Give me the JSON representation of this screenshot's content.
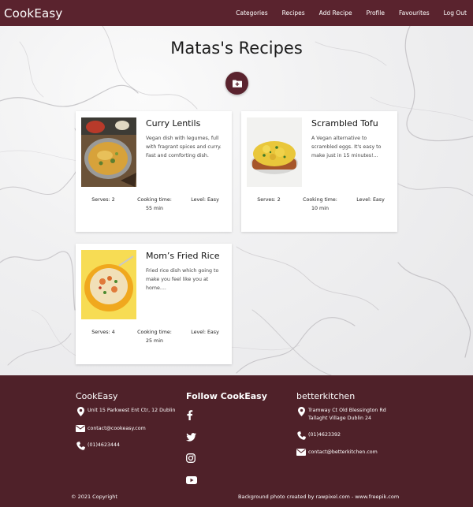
{
  "navbar": {
    "brand": "CookEasy",
    "links": [
      "Categories",
      "Recipes",
      "Add Recipe",
      "Profile",
      "Favourites",
      "Log Out"
    ]
  },
  "page": {
    "title": "Matas's Recipes",
    "add_icon": "folder-plus-icon"
  },
  "recipes": [
    {
      "title": "Curry Lentils",
      "description": "Vegan dish with legumes, full with fragrant spices and curry. Fast and comforting dish.",
      "serves": "Serves: 2",
      "time_label": "Cooking time:",
      "time_value": "55 min",
      "level": "Level: Easy"
    },
    {
      "title": "Scrambled Tofu",
      "description": "A Vegan alternative to scrambled eggs. It's easy to make just in 15 minutes!...",
      "serves": "Serves: 2",
      "time_label": "Cooking time:",
      "time_value": "10 min",
      "level": "Level: Easy"
    },
    {
      "title": "Mom’s Fried Rice",
      "description": "Fried rice dish which going to make you feel like you at home....",
      "serves": "Serves: 4",
      "time_label": "Cooking time:",
      "time_value": "25 min",
      "level": "Level: Easy"
    }
  ],
  "footer": {
    "col1": {
      "heading": "CookEasy",
      "address": "Unit 15 Parkwest Ent Ctr, 12 Dublin",
      "email": "contact@cookeasy.com",
      "phone": "(01)4623444"
    },
    "col2": {
      "heading": "Follow CookEasy",
      "icons": [
        "facebook-icon",
        "twitter-icon",
        "instagram-icon",
        "youtube-icon"
      ]
    },
    "col3": {
      "heading": "betterkitchen",
      "address_line1": "Tramway Ct Old Blessington Rd",
      "address_line2": "Tallaght Village Dublin 24",
      "phone": "(01)4623392",
      "email": "contact@betterkitchen.com"
    },
    "copyright": "© 2021 Copyright",
    "credit": "Background photo created by rawpixel.com - www.freepik.com"
  },
  "colors": {
    "brand": "#5a232e",
    "footer": "#4f2129"
  }
}
